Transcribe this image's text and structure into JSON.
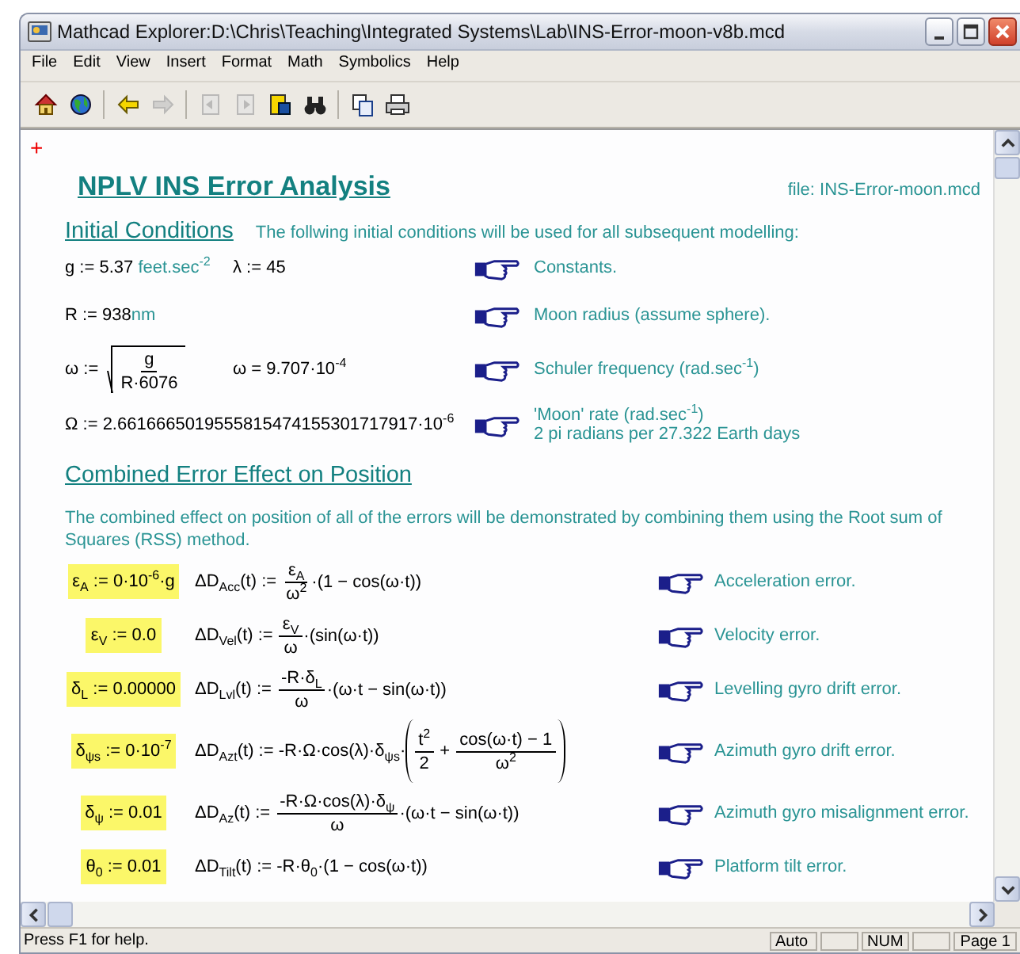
{
  "window": {
    "title": "Mathcad Explorer:D:\\Chris\\Teaching\\Integrated Systems\\Lab\\INS-Error-moon-v8b.mcd"
  },
  "menu": [
    "File",
    "Edit",
    "View",
    "Insert",
    "Format",
    "Math",
    "Symbolics",
    "Help"
  ],
  "toolbar": [
    {
      "kind": "home",
      "disabled": false
    },
    {
      "kind": "globe",
      "disabled": false
    },
    {
      "kind": "back",
      "disabled": false
    },
    {
      "kind": "forward",
      "disabled": true
    },
    {
      "kind": "first",
      "disabled": true
    },
    {
      "kind": "last",
      "disabled": true
    },
    {
      "kind": "bookmark",
      "disabled": false
    },
    {
      "kind": "find",
      "disabled": false
    },
    {
      "kind": "copy",
      "disabled": false
    },
    {
      "kind": "print",
      "disabled": false
    }
  ],
  "document": {
    "marker": "+",
    "title": "NPLV INS Error Analysis",
    "file_note": "file: INS-Error-moon.mcd",
    "initial": {
      "heading": "Initial Conditions",
      "intro": "The follwing initial conditions will be used for all subsequent modelling:",
      "rows": [
        {
          "expressions": [
            [
              {
                "kind": "text",
                "text": "g := 5.37 "
              },
              {
                "kind": "unit",
                "text": "feet.sec$^{-2}$"
              }
            ],
            [
              {
                "kind": "text",
                "text": "λ := 45"
              }
            ]
          ],
          "note": [
            "Constants."
          ]
        },
        {
          "expressions": [
            [
              {
                "kind": "text",
                "text": "R := 938"
              },
              {
                "kind": "unit",
                "text": "nm"
              }
            ]
          ],
          "note": [
            "Moon radius (assume sphere)."
          ]
        },
        {
          "expressions": [
            [
              {
                "kind": "text",
                "text": "ω := "
              },
              {
                "kind": "sqrt",
                "body": [
                  {
                    "kind": "frac",
                    "num": "g",
                    "den": "R·6076"
                  }
                ]
              }
            ],
            [
              {
                "kind": "text",
                "text": "ω = 9.707·10$^{-4}$"
              }
            ]
          ],
          "note": [
            "Schuler frequency (rad.sec$^{-1}$)"
          ]
        },
        {
          "expressions": [
            [
              {
                "kind": "text",
                "text": "Ω := 2.6616665019555815474155301717917·10$^{-6}$"
              }
            ]
          ],
          "note": [
            "'Moon' rate (rad.sec$^{-1}$)",
            "2 pi radians per 27.322 Earth days"
          ]
        }
      ]
    },
    "combined": {
      "heading": "Combined Error Effect on Position",
      "intro": "The combined effect on position of all of the errors will be demonstrated by combining them using the Root sum of Squares (RSS) method.",
      "rows": [
        {
          "param": {
            "text": "ε$_{A}$ := 0·10$^{-6}$·g",
            "highlighted": true
          },
          "formula": [
            {
              "kind": "text",
              "text": "ΔD$_{Acc}$(t) := "
            },
            {
              "kind": "frac",
              "num": "ε$_{A}$",
              "den": "ω$^{2}$"
            },
            {
              "kind": "text",
              "text": "·(1 − cos(ω·t))"
            }
          ],
          "note": "Acceleration error."
        },
        {
          "param": {
            "text": "ε$_{V}$ := 0.0",
            "highlighted": true
          },
          "formula": [
            {
              "kind": "text",
              "text": "ΔD$_{Vel}$(t) := "
            },
            {
              "kind": "frac",
              "num": "ε$_{V}$",
              "den": "ω"
            },
            {
              "kind": "text",
              "text": "·(sin(ω·t))"
            }
          ],
          "note": "Velocity error."
        },
        {
          "param": {
            "text": "δ$_{L}$ := 0.00000",
            "highlighted": true
          },
          "formula": [
            {
              "kind": "text",
              "text": "ΔD$_{Lvl}$(t) := "
            },
            {
              "kind": "frac",
              "num": "-R·δ$_{L}$",
              "den": "ω"
            },
            {
              "kind": "text",
              "text": "·(ω·t − sin(ω·t))"
            }
          ],
          "note": "Levelling gyro drift error."
        },
        {
          "param": {
            "text": "δ$_{ψs}$ := 0·10$^{-7}$",
            "highlighted": true
          },
          "formula": [
            {
              "kind": "text",
              "text": "ΔD$_{Azt}$(t) := -R·Ω·cos(λ)·δ$_{ψs}$·"
            },
            {
              "kind": "paren",
              "body": [
                {
                  "kind": "frac",
                  "num": "t$^{2}$",
                  "den": "2"
                },
                {
                  "kind": "text",
                  "text": " + "
                },
                {
                  "kind": "frac",
                  "num": "cos(ω·t) − 1",
                  "den": "ω$^{2}$"
                }
              ]
            }
          ],
          "note": "Azimuth gyro drift error."
        },
        {
          "param": {
            "text": "δ$_{ψ}$ := 0.01",
            "highlighted": true
          },
          "formula": [
            {
              "kind": "text",
              "text": "ΔD$_{Az}$(t) := "
            },
            {
              "kind": "frac",
              "num": "-R·Ω·cos(λ)·δ$_{ψ}$",
              "den": "ω"
            },
            {
              "kind": "text",
              "text": "·(ω·t − sin(ω·t))"
            }
          ],
          "note": "Azimuth gyro misalignment error."
        },
        {
          "param": {
            "text": "θ$_{0}$ := 0.01",
            "highlighted": true
          },
          "formula": [
            {
              "kind": "text",
              "text": "ΔD$_{Tilt}$(t) := -R·θ$_{0}$·(1 − cos(ω·t))"
            }
          ],
          "note": "Platform tilt error."
        }
      ]
    }
  },
  "status_bar": {
    "message": "Press F1 for help.",
    "panels": [
      {
        "text": "Auto"
      },
      {
        "text": "NUM"
      },
      {
        "text": "Page 1"
      }
    ]
  }
}
